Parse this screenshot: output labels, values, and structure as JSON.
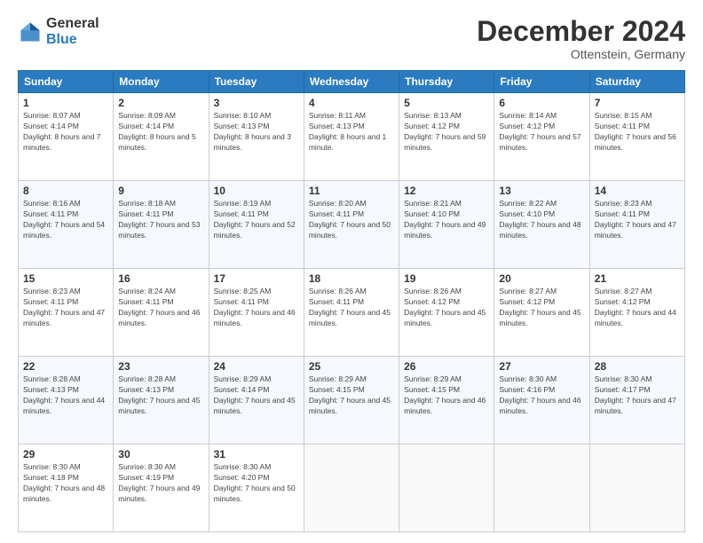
{
  "header": {
    "logo_general": "General",
    "logo_blue": "Blue",
    "month_title": "December 2024",
    "location": "Ottenstein, Germany"
  },
  "days_of_week": [
    "Sunday",
    "Monday",
    "Tuesday",
    "Wednesday",
    "Thursday",
    "Friday",
    "Saturday"
  ],
  "weeks": [
    [
      {
        "day": "1",
        "sunrise": "Sunrise: 8:07 AM",
        "sunset": "Sunset: 4:14 PM",
        "daylight": "Daylight: 8 hours and 7 minutes."
      },
      {
        "day": "2",
        "sunrise": "Sunrise: 8:09 AM",
        "sunset": "Sunset: 4:14 PM",
        "daylight": "Daylight: 8 hours and 5 minutes."
      },
      {
        "day": "3",
        "sunrise": "Sunrise: 8:10 AM",
        "sunset": "Sunset: 4:13 PM",
        "daylight": "Daylight: 8 hours and 3 minutes."
      },
      {
        "day": "4",
        "sunrise": "Sunrise: 8:11 AM",
        "sunset": "Sunset: 4:13 PM",
        "daylight": "Daylight: 8 hours and 1 minute."
      },
      {
        "day": "5",
        "sunrise": "Sunrise: 8:13 AM",
        "sunset": "Sunset: 4:12 PM",
        "daylight": "Daylight: 7 hours and 59 minutes."
      },
      {
        "day": "6",
        "sunrise": "Sunrise: 8:14 AM",
        "sunset": "Sunset: 4:12 PM",
        "daylight": "Daylight: 7 hours and 57 minutes."
      },
      {
        "day": "7",
        "sunrise": "Sunrise: 8:15 AM",
        "sunset": "Sunset: 4:11 PM",
        "daylight": "Daylight: 7 hours and 56 minutes."
      }
    ],
    [
      {
        "day": "8",
        "sunrise": "Sunrise: 8:16 AM",
        "sunset": "Sunset: 4:11 PM",
        "daylight": "Daylight: 7 hours and 54 minutes."
      },
      {
        "day": "9",
        "sunrise": "Sunrise: 8:18 AM",
        "sunset": "Sunset: 4:11 PM",
        "daylight": "Daylight: 7 hours and 53 minutes."
      },
      {
        "day": "10",
        "sunrise": "Sunrise: 8:19 AM",
        "sunset": "Sunset: 4:11 PM",
        "daylight": "Daylight: 7 hours and 52 minutes."
      },
      {
        "day": "11",
        "sunrise": "Sunrise: 8:20 AM",
        "sunset": "Sunset: 4:11 PM",
        "daylight": "Daylight: 7 hours and 50 minutes."
      },
      {
        "day": "12",
        "sunrise": "Sunrise: 8:21 AM",
        "sunset": "Sunset: 4:10 PM",
        "daylight": "Daylight: 7 hours and 49 minutes."
      },
      {
        "day": "13",
        "sunrise": "Sunrise: 8:22 AM",
        "sunset": "Sunset: 4:10 PM",
        "daylight": "Daylight: 7 hours and 48 minutes."
      },
      {
        "day": "14",
        "sunrise": "Sunrise: 8:23 AM",
        "sunset": "Sunset: 4:11 PM",
        "daylight": "Daylight: 7 hours and 47 minutes."
      }
    ],
    [
      {
        "day": "15",
        "sunrise": "Sunrise: 8:23 AM",
        "sunset": "Sunset: 4:11 PM",
        "daylight": "Daylight: 7 hours and 47 minutes."
      },
      {
        "day": "16",
        "sunrise": "Sunrise: 8:24 AM",
        "sunset": "Sunset: 4:11 PM",
        "daylight": "Daylight: 7 hours and 46 minutes."
      },
      {
        "day": "17",
        "sunrise": "Sunrise: 8:25 AM",
        "sunset": "Sunset: 4:11 PM",
        "daylight": "Daylight: 7 hours and 46 minutes."
      },
      {
        "day": "18",
        "sunrise": "Sunrise: 8:26 AM",
        "sunset": "Sunset: 4:11 PM",
        "daylight": "Daylight: 7 hours and 45 minutes."
      },
      {
        "day": "19",
        "sunrise": "Sunrise: 8:26 AM",
        "sunset": "Sunset: 4:12 PM",
        "daylight": "Daylight: 7 hours and 45 minutes."
      },
      {
        "day": "20",
        "sunrise": "Sunrise: 8:27 AM",
        "sunset": "Sunset: 4:12 PM",
        "daylight": "Daylight: 7 hours and 45 minutes."
      },
      {
        "day": "21",
        "sunrise": "Sunrise: 8:27 AM",
        "sunset": "Sunset: 4:12 PM",
        "daylight": "Daylight: 7 hours and 44 minutes."
      }
    ],
    [
      {
        "day": "22",
        "sunrise": "Sunrise: 8:28 AM",
        "sunset": "Sunset: 4:13 PM",
        "daylight": "Daylight: 7 hours and 44 minutes."
      },
      {
        "day": "23",
        "sunrise": "Sunrise: 8:28 AM",
        "sunset": "Sunset: 4:13 PM",
        "daylight": "Daylight: 7 hours and 45 minutes."
      },
      {
        "day": "24",
        "sunrise": "Sunrise: 8:29 AM",
        "sunset": "Sunset: 4:14 PM",
        "daylight": "Daylight: 7 hours and 45 minutes."
      },
      {
        "day": "25",
        "sunrise": "Sunrise: 8:29 AM",
        "sunset": "Sunset: 4:15 PM",
        "daylight": "Daylight: 7 hours and 45 minutes."
      },
      {
        "day": "26",
        "sunrise": "Sunrise: 8:29 AM",
        "sunset": "Sunset: 4:15 PM",
        "daylight": "Daylight: 7 hours and 46 minutes."
      },
      {
        "day": "27",
        "sunrise": "Sunrise: 8:30 AM",
        "sunset": "Sunset: 4:16 PM",
        "daylight": "Daylight: 7 hours and 46 minutes."
      },
      {
        "day": "28",
        "sunrise": "Sunrise: 8:30 AM",
        "sunset": "Sunset: 4:17 PM",
        "daylight": "Daylight: 7 hours and 47 minutes."
      }
    ],
    [
      {
        "day": "29",
        "sunrise": "Sunrise: 8:30 AM",
        "sunset": "Sunset: 4:18 PM",
        "daylight": "Daylight: 7 hours and 48 minutes."
      },
      {
        "day": "30",
        "sunrise": "Sunrise: 8:30 AM",
        "sunset": "Sunset: 4:19 PM",
        "daylight": "Daylight: 7 hours and 49 minutes."
      },
      {
        "day": "31",
        "sunrise": "Sunrise: 8:30 AM",
        "sunset": "Sunset: 4:20 PM",
        "daylight": "Daylight: 7 hours and 50 minutes."
      },
      null,
      null,
      null,
      null
    ]
  ]
}
